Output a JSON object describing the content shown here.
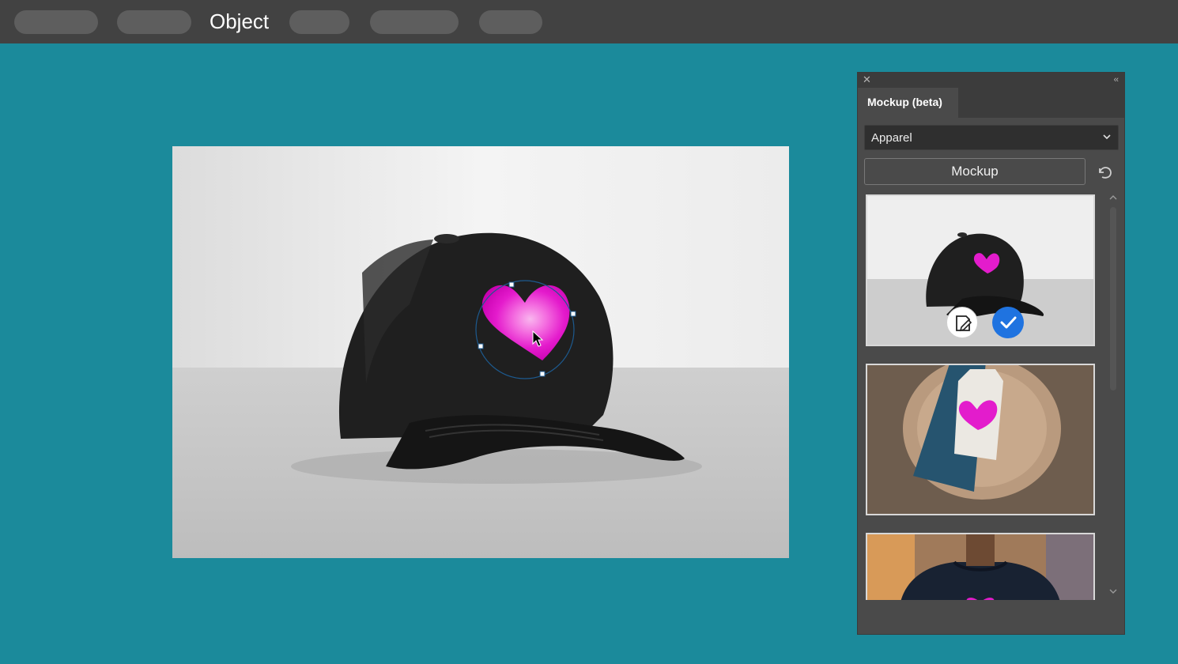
{
  "menubar": {
    "active_menu_label": "Object"
  },
  "panel": {
    "tab_label": "Mockup (beta)",
    "category_select": "Apparel",
    "mockup_button_label": "Mockup"
  },
  "colors": {
    "background": "#1b8a9b",
    "menubar": "#424242",
    "panel": "#4a4a4a",
    "accent_check": "#1f73e0",
    "heart_magenta": "#e600c8"
  },
  "icons": {
    "panel_close": "close-icon",
    "panel_collapse": "double-chevron-left-icon",
    "dropdown": "chevron-down-icon",
    "refresh": "refresh-icon",
    "edit": "edit-icon",
    "check": "check-icon",
    "cursor": "arrow-cursor-icon"
  }
}
